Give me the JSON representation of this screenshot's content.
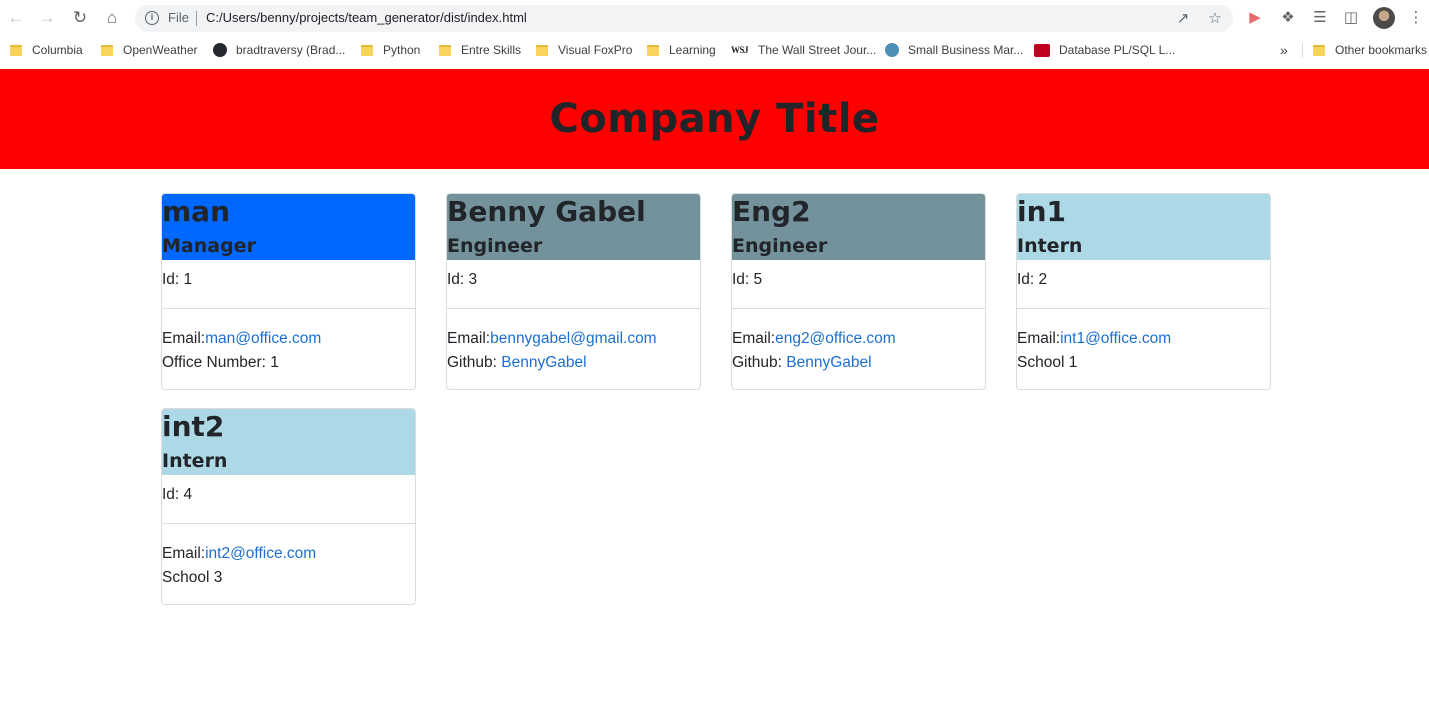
{
  "browser": {
    "file_label": "File",
    "url": "C:/Users/benny/projects/team_generator/dist/index.html",
    "bookmarks": [
      {
        "label": "Columbia",
        "icon": "folder-icon"
      },
      {
        "label": "OpenWeather",
        "icon": "folder-icon"
      },
      {
        "label": "bradtraversy (Brad...",
        "icon": "github-icon"
      },
      {
        "label": "Python",
        "icon": "folder-icon"
      },
      {
        "label": "Entre Skills",
        "icon": "folder-icon"
      },
      {
        "label": "Visual FoxPro",
        "icon": "folder-icon"
      },
      {
        "label": "Learning",
        "icon": "folder-icon"
      },
      {
        "label": "The Wall Street Jour...",
        "icon": "wsj-icon"
      },
      {
        "label": "Small Business Mar...",
        "icon": "k-icon"
      },
      {
        "label": "Database PL/SQL L...",
        "icon": "oracle-icon"
      }
    ],
    "overflow": "»",
    "other_bookmarks": "Other bookmarks"
  },
  "page": {
    "title": "Company Title",
    "cards": [
      {
        "name": "man",
        "role": "Manager",
        "id": "Id: 1",
        "email_prefix": "Email:",
        "email": "man@office.com",
        "extra_prefix": "Office Number: 1",
        "extra_link": "",
        "color": "#0068ff"
      },
      {
        "name": "Benny Gabel",
        "role": "Engineer",
        "id": "Id: 3",
        "email_prefix": "Email:",
        "email": "bennygabel@gmail.com",
        "extra_prefix": "Github: ",
        "extra_link": "BennyGabel",
        "color": "#73929b"
      },
      {
        "name": "Eng2",
        "role": "Engineer",
        "id": "Id: 5",
        "email_prefix": "Email:",
        "email": "eng2@office.com",
        "extra_prefix": "Github: ",
        "extra_link": "BennyGabel",
        "color": "#73929b"
      },
      {
        "name": "in1",
        "role": "Intern",
        "id": "Id: 2",
        "email_prefix": "Email:",
        "email": "int1@office.com",
        "extra_prefix": "School 1",
        "extra_link": "",
        "color": "#add8e6"
      },
      {
        "name": "int2",
        "role": "Intern",
        "id": "Id: 4",
        "email_prefix": "Email:",
        "email": "int2@office.com",
        "extra_prefix": "School 3",
        "extra_link": "",
        "color": "#add8e6"
      }
    ]
  }
}
